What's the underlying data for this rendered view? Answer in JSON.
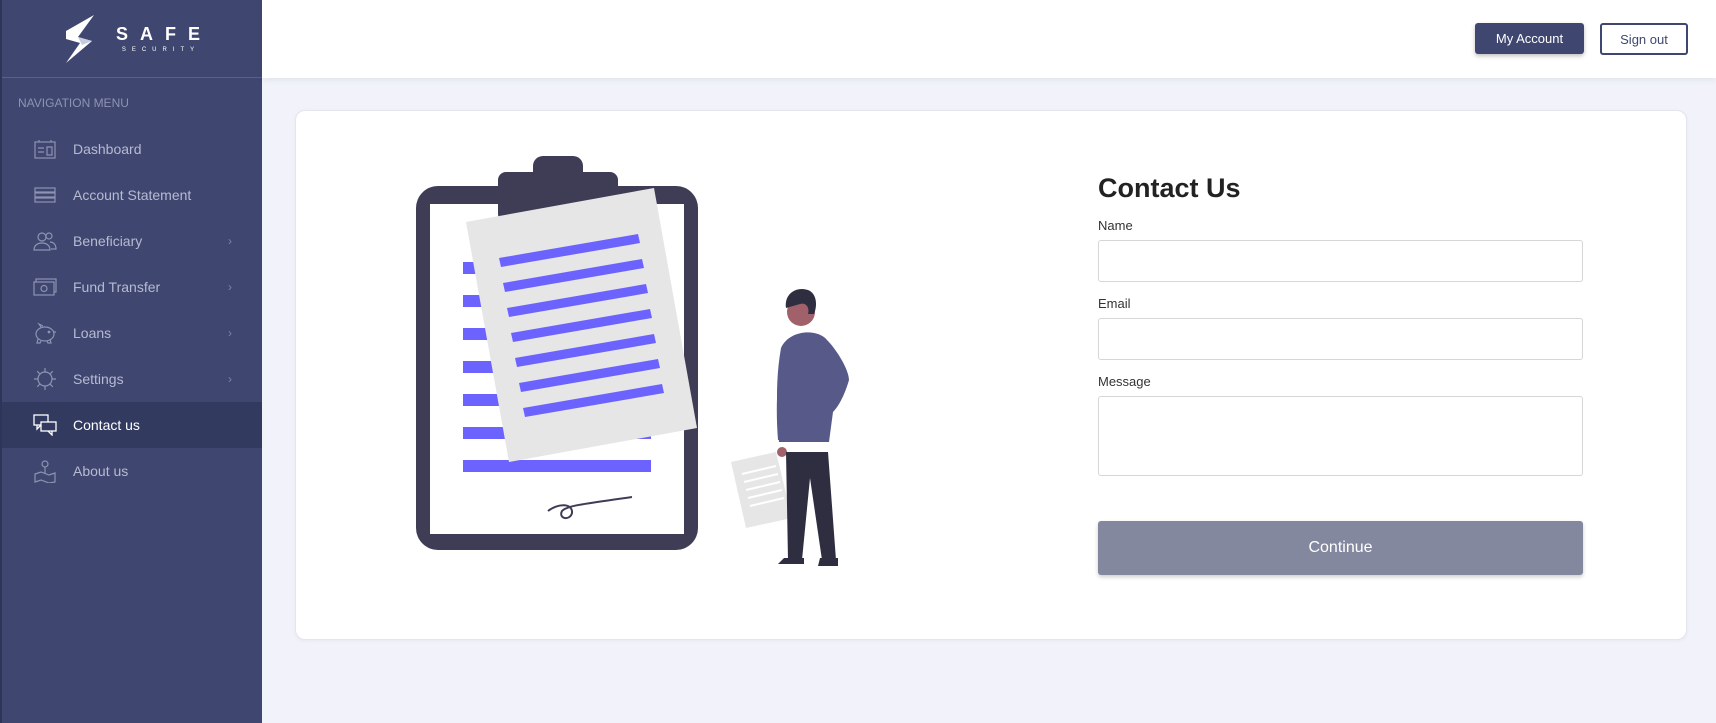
{
  "brand": {
    "name": "SAFE",
    "tagline": "SECURITY"
  },
  "sidebar": {
    "heading": "Navigation Menu",
    "items": [
      {
        "label": "Dashboard",
        "icon": "dashboard-icon",
        "has_submenu": false,
        "active": false
      },
      {
        "label": "Account Statement",
        "icon": "statement-icon",
        "has_submenu": false,
        "active": false
      },
      {
        "label": "Beneficiary",
        "icon": "users-icon",
        "has_submenu": true,
        "active": false
      },
      {
        "label": "Fund Transfer",
        "icon": "money-icon",
        "has_submenu": true,
        "active": false
      },
      {
        "label": "Loans",
        "icon": "piggy-bank-icon",
        "has_submenu": true,
        "active": false
      },
      {
        "label": "Settings",
        "icon": "gear-icon",
        "has_submenu": true,
        "active": false
      },
      {
        "label": "Contact us",
        "icon": "chat-icon",
        "has_submenu": false,
        "active": true
      },
      {
        "label": "About us",
        "icon": "map-icon",
        "has_submenu": false,
        "active": false
      }
    ]
  },
  "header": {
    "account_label": "My Account",
    "signout_label": "Sign out"
  },
  "contact": {
    "title": "Contact Us",
    "name_label": "Name",
    "name_value": "",
    "email_label": "Email",
    "email_value": "",
    "message_label": "Message",
    "message_value": "",
    "submit_label": "Continue"
  },
  "colors": {
    "sidebar": "#3f4770",
    "accent": "#6c63ff",
    "button_disabled": "#84889f"
  }
}
